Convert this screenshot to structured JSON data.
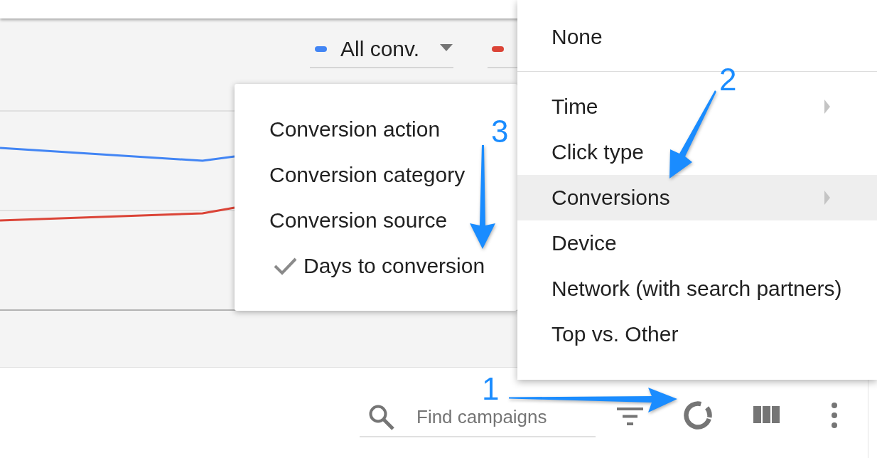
{
  "chart": {
    "legend": [
      {
        "label": "All conv.",
        "color": "#4285f4"
      },
      {
        "color": "#db4437"
      }
    ]
  },
  "submenu": {
    "items": [
      {
        "label": "Conversion action",
        "checked": false
      },
      {
        "label": "Conversion category",
        "checked": false
      },
      {
        "label": "Conversion source",
        "checked": false
      },
      {
        "label": "Days to conversion",
        "checked": true
      }
    ]
  },
  "breakdown_menu": {
    "sections": [
      {
        "items": [
          {
            "label": "None",
            "has_submenu": false,
            "selected": false
          }
        ]
      },
      {
        "items": [
          {
            "label": "Time",
            "has_submenu": true,
            "selected": false
          },
          {
            "label": "Click type",
            "has_submenu": false,
            "selected": false
          },
          {
            "label": "Conversions",
            "has_submenu": true,
            "selected": true
          },
          {
            "label": "Device",
            "has_submenu": false,
            "selected": false
          },
          {
            "label": "Network (with search partners)",
            "has_submenu": false,
            "selected": false
          },
          {
            "label": "Top vs. Other",
            "has_submenu": false,
            "selected": false
          }
        ]
      }
    ]
  },
  "toolbar": {
    "search": {
      "placeholder": "Find campaigns"
    }
  },
  "annotations": [
    {
      "number": "1"
    },
    {
      "number": "2"
    },
    {
      "number": "3"
    }
  ]
}
